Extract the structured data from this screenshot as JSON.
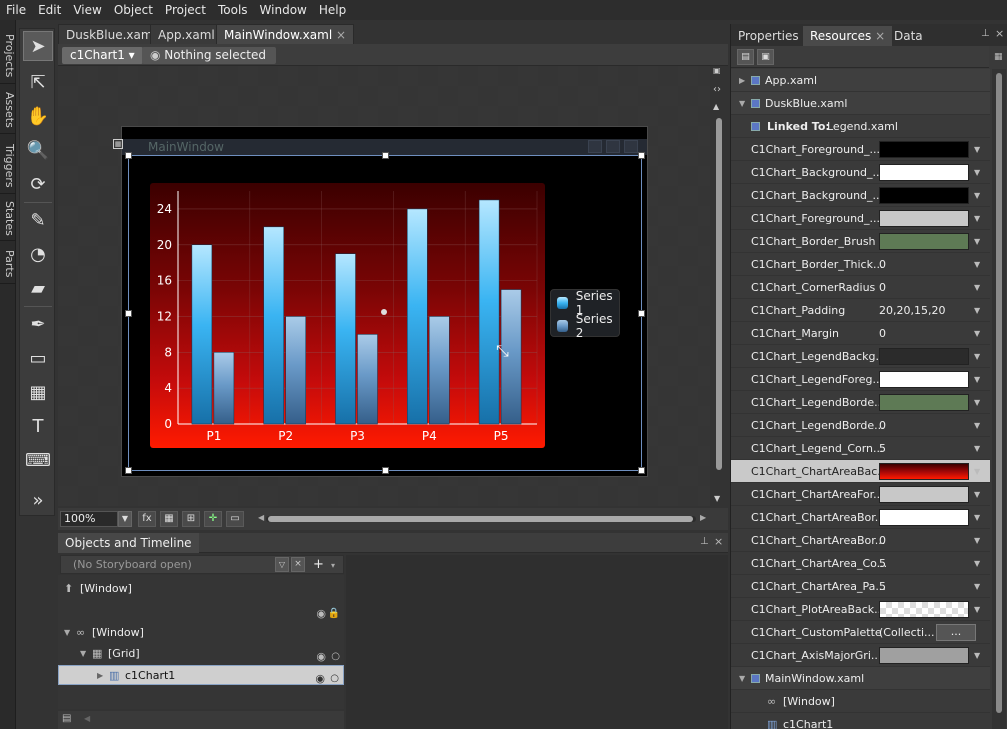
{
  "menu": [
    "File",
    "Edit",
    "View",
    "Object",
    "Project",
    "Tools",
    "Window",
    "Help"
  ],
  "side_tabs": [
    "Projects",
    "Assets",
    "Triggers",
    "States",
    "Parts"
  ],
  "doc_tabs": [
    {
      "label": "DuskBlue.xaml"
    },
    {
      "label": "App.xaml"
    },
    {
      "label": "MainWindow.xaml",
      "close": "×"
    }
  ],
  "breadcrumb": {
    "element": "c1Chart1 ▾",
    "selection": "Nothing selected"
  },
  "window_title": "MainWindow",
  "zoom": "100%",
  "chart_data": {
    "type": "bar",
    "categories": [
      "P1",
      "P2",
      "P3",
      "P4",
      "P5"
    ],
    "series": [
      {
        "name": "Series 1",
        "values": [
          20,
          22,
          19,
          24,
          25
        ],
        "color": "#3ab4f2"
      },
      {
        "name": "Series 2",
        "values": [
          8,
          12,
          10,
          12,
          15
        ],
        "color": "#6a9ac8"
      }
    ],
    "yticks": [
      "0",
      "4",
      "8",
      "12",
      "16",
      "20",
      "24"
    ],
    "ylim": [
      0,
      26
    ],
    "grid": true,
    "legend": "right"
  },
  "timeline": {
    "title": "Objects and Timeline",
    "storyboard": "(No Storyboard open)",
    "rows": [
      {
        "label": "[Window]"
      },
      {
        "label": "[Window]"
      },
      {
        "label": "[Grid]"
      },
      {
        "label": "c1Chart1"
      }
    ]
  },
  "right_panel": {
    "tabs": [
      "Properties",
      "Resources",
      "Data"
    ],
    "close_glyph": "×",
    "files": {
      "app": "App.xaml",
      "dusk": "DuskBlue.xaml",
      "main": "MainWindow.xaml"
    },
    "linked_label": "Linked To:",
    "linked_value": "Legend.xaml",
    "resources": [
      {
        "name": "C1Chart_Foreground_...",
        "swatch": "#000000"
      },
      {
        "name": "C1Chart_Background_...",
        "swatch": "#ffffff"
      },
      {
        "name": "C1Chart_Background_...",
        "swatch": "#000000"
      },
      {
        "name": "C1Chart_Foreground_...",
        "swatch": "#c8c8c8"
      },
      {
        "name": "C1Chart_Border_Brush",
        "swatch": "#5e7a55"
      },
      {
        "name": "C1Chart_Border_Thick...",
        "value": "0"
      },
      {
        "name": "C1Chart_CornerRadius",
        "value": "0"
      },
      {
        "name": "C1Chart_Padding",
        "value": "20,20,15,20"
      },
      {
        "name": "C1Chart_Margin",
        "value": "0"
      },
      {
        "name": "C1Chart_LegendBackg...",
        "swatch": "#2b2b2b"
      },
      {
        "name": "C1Chart_LegendForeg...",
        "swatch": "#ffffff"
      },
      {
        "name": "C1Chart_LegendBorde...",
        "swatch": "#5e7a55"
      },
      {
        "name": "C1Chart_LegendBorde...",
        "value": "0"
      },
      {
        "name": "C1Chart_Legend_Corn...",
        "value": "5"
      },
      {
        "name": "C1Chart_ChartAreaBac...",
        "swatch": "gradient",
        "selected": true
      },
      {
        "name": "C1Chart_ChartAreaFor...",
        "swatch": "#c8c8c8"
      },
      {
        "name": "C1Chart_ChartAreaBor...",
        "swatch": "#ffffff"
      },
      {
        "name": "C1Chart_ChartAreaBor...",
        "value": "0"
      },
      {
        "name": "C1Chart_ChartArea_Co...",
        "value": "5"
      },
      {
        "name": "C1Chart_ChartArea_Pa...",
        "value": "5"
      },
      {
        "name": "C1Chart_PlotAreaBack...",
        "swatch": "checker"
      },
      {
        "name": "C1Chart_CustomPalette",
        "value": "(Collecti...",
        "button": "..."
      },
      {
        "name": "C1Chart_AxisMajorGri...",
        "swatch": "#a0a0a0"
      }
    ],
    "main_children": [
      "[Window]",
      "c1Chart1"
    ]
  }
}
